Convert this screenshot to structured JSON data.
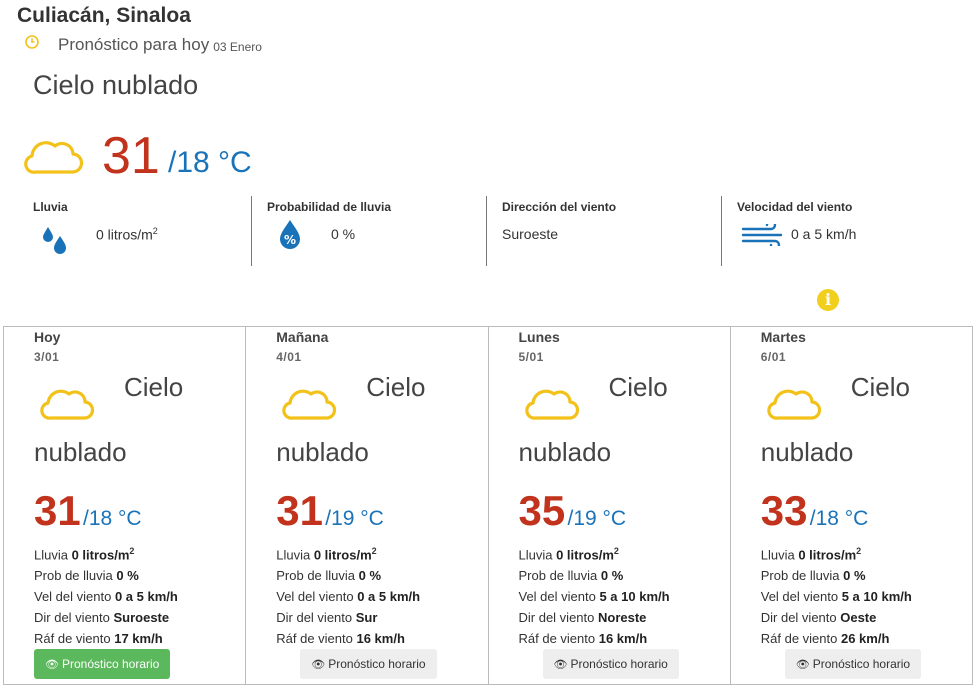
{
  "header": {
    "city": "Culiacán, Sinaloa",
    "subtitle": "Pronóstico para hoy",
    "date": "03 Enero"
  },
  "today": {
    "condition": "Cielo nublado",
    "temp_max": "31",
    "temp_min": "/18 °C",
    "stats": {
      "rain_label": "Lluvia",
      "rain_value": "0 litros/m",
      "rain_unit_sup": "2",
      "prob_label": "Probabilidad de lluvia",
      "prob_value": "0 %",
      "wind_dir_label": "Dirección del viento",
      "wind_dir_value": "Suroeste",
      "wind_speed_label": "Velocidad del viento",
      "wind_speed_value": "0 a 5 km/h"
    }
  },
  "info_icon": "i",
  "days": [
    {
      "name": "Hoy",
      "date": "3/01",
      "cond1": "Cielo",
      "cond2": "nublado",
      "max": "31",
      "min": "/18 °C",
      "rain_l": "Lluvia ",
      "rain_v": "0 litros/m",
      "rain_sup": "2",
      "prob_l": "Prob de lluvia ",
      "prob_v": "0 %",
      "vel_l": "Vel del viento ",
      "vel_v": "0 a 5 km/h",
      "dir_l": "Dir del viento ",
      "dir_v": "Suroeste",
      "raf_l": "Ráf de viento ",
      "raf_v": "17 km/h",
      "button": "Pronóstico horario"
    },
    {
      "name": "Mañana",
      "date": "4/01",
      "cond1": "Cielo",
      "cond2": "nublado",
      "max": "31",
      "min": "/19 °C",
      "rain_l": "Lluvia ",
      "rain_v": "0 litros/m",
      "rain_sup": "2",
      "prob_l": "Prob de lluvia ",
      "prob_v": "0 %",
      "vel_l": "Vel del viento ",
      "vel_v": "0 a 5 km/h",
      "dir_l": "Dir del viento ",
      "dir_v": "Sur",
      "raf_l": "Ráf de viento ",
      "raf_v": "16 km/h",
      "button": "Pronóstico horario"
    },
    {
      "name": "Lunes",
      "date": "5/01",
      "cond1": "Cielo",
      "cond2": "nublado",
      "max": "35",
      "min": "/19 °C",
      "rain_l": "Lluvia ",
      "rain_v": "0 litros/m",
      "rain_sup": "2",
      "prob_l": "Prob de lluvia ",
      "prob_v": "0 %",
      "vel_l": "Vel del viento ",
      "vel_v": "5 a 10 km/h",
      "dir_l": "Dir del viento ",
      "dir_v": "Noreste",
      "raf_l": "Ráf de viento ",
      "raf_v": "16 km/h",
      "button": "Pronóstico horario"
    },
    {
      "name": "Martes",
      "date": "6/01",
      "cond1": "Cielo",
      "cond2": "nublado",
      "max": "33",
      "min": "/18 °C",
      "rain_l": "Lluvia ",
      "rain_v": "0 litros/m",
      "rain_sup": "2",
      "prob_l": "Prob de lluvia ",
      "prob_v": "0 %",
      "vel_l": "Vel del viento ",
      "vel_v": "5 a 10 km/h",
      "dir_l": "Dir del viento ",
      "dir_v": "Oeste",
      "raf_l": "Ráf de viento ",
      "raf_v": "26 km/h",
      "button": "Pronóstico horario"
    }
  ],
  "colors": {
    "temp_max": "#c1331c",
    "temp_min": "#1a73b8",
    "cloud": "#f2c21b",
    "rain_icon": "#1a73b8",
    "active_button": "#5cb85c"
  },
  "icons": {
    "clock": "clock-icon",
    "cloud": "cloud-icon",
    "rain": "rain-drops-icon",
    "probability": "percent-drop-icon",
    "wind": "wind-icon",
    "info": "info-icon",
    "eye": "eye-icon"
  }
}
